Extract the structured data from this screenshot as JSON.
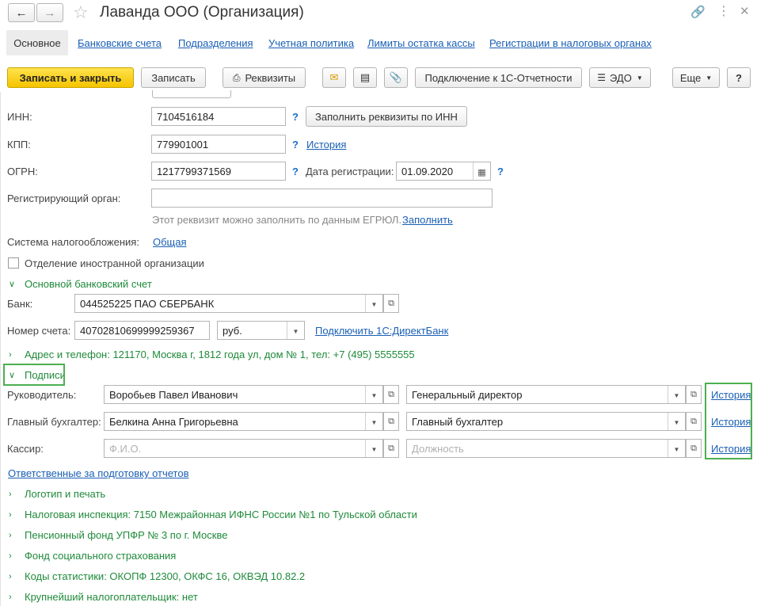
{
  "window": {
    "title": "Лаванда ООО (Организация)"
  },
  "tabs": [
    {
      "label": "Основное"
    },
    {
      "label": "Банковские счета"
    },
    {
      "label": "Подразделения"
    },
    {
      "label": "Учетная политика"
    },
    {
      "label": "Лимиты остатка кассы"
    },
    {
      "label": "Регистрации в налоговых органах"
    }
  ],
  "toolbar": {
    "save_close": "Записать и закрыть",
    "save": "Записать",
    "requisites": "Реквизиты",
    "connect_reporting": "Подключение к 1С-Отчетности",
    "edo": "ЭДО",
    "more": "Еще",
    "help": "?"
  },
  "form": {
    "inn": {
      "label": "ИНН:",
      "value": "7104516184",
      "fill_button": "Заполнить реквизиты по ИНН"
    },
    "kpp": {
      "label": "КПП:",
      "value": "779901001",
      "history": "История"
    },
    "ogrn": {
      "label": "ОГРН:",
      "value": "1217799371569",
      "reg_date_label": "Дата регистрации:",
      "reg_date": "01.09.2020"
    },
    "reg_organ": {
      "label": "Регистрирующий орган:",
      "value": "",
      "hint": "Этот реквизит можно заполнить по данным ЕГРЮЛ.",
      "fill_link": "Заполнить"
    },
    "tax_system": {
      "label": "Система налогообложения:",
      "value": "Общая"
    },
    "foreign_branch": {
      "label": "Отделение иностранной организации",
      "checked": false
    },
    "bank_group": {
      "title": "Основной банковский счет"
    },
    "bank": {
      "label": "Банк:",
      "value": "044525225 ПАО СБЕРБАНК"
    },
    "account": {
      "label": "Номер счета:",
      "value": "40702810699999259367",
      "currency": "руб.",
      "directbank_link": "Подключить 1С:ДиректБанк"
    },
    "address_group": {
      "title": "Адрес и телефон: 121170, Москва г, 1812 года ул, дом № 1, тел: +7 (495) 5555555"
    },
    "signatures_group": {
      "title": "Подписи"
    },
    "director": {
      "label": "Руководитель:",
      "name": "Воробьев Павел Иванович",
      "position": "Генеральный директор",
      "history": "История"
    },
    "accountant": {
      "label": "Главный бухгалтер:",
      "name": "Белкина Анна Григорьевна",
      "position": "Главный бухгалтер",
      "history": "История"
    },
    "cashier": {
      "label": "Кассир:",
      "name_placeholder": "Ф.И.О.",
      "position_placeholder": "Должность",
      "history": "История"
    },
    "responsible_link": "Ответственные за подготовку отчетов",
    "collapsed_groups": [
      "Логотип и печать",
      "Налоговая инспекция: 7150 Межрайонная ИФНС России №1 по Тульской области",
      "Пенсионный фонд УПФР № 3 по г. Москве",
      "Фонд социального страхования",
      "Коды статистики: ОКОПФ 12300, ОКФС 16, ОКВЭД 10.82.2",
      "Крупнейший налогоплательщик: нет"
    ]
  },
  "colors": {
    "accent_yellow": "#f5c400",
    "link_blue": "#1a5fb4",
    "group_green": "#1f8a3a",
    "highlight_green": "#4caf50"
  }
}
